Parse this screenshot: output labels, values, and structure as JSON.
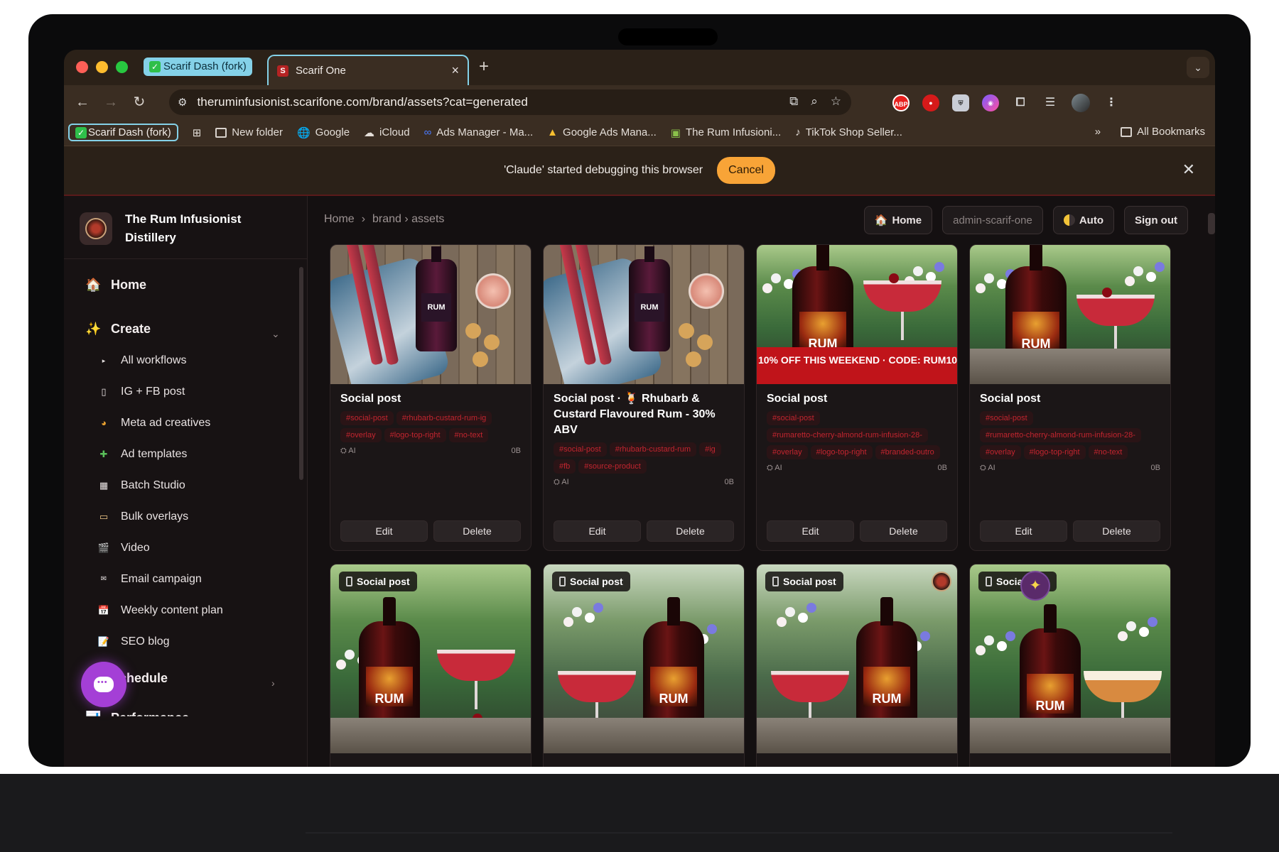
{
  "browser": {
    "tab_group_label": "Scarif Dash (fork)",
    "active_tab_title": "Scarif One",
    "active_tab_favicon": "S",
    "url": "theruminfusionist.scarifone.com/brand/assets?cat=generated",
    "bookmarks": {
      "group_chip": "Scarif Dash (fork)",
      "items": [
        "New folder",
        "Google",
        "iCloud",
        "Ads Manager - Ma...",
        "Google Ads Mana...",
        "The Rum Infusioni...",
        "TikTok Shop Seller..."
      ],
      "overflow": "»",
      "all_bookmarks": "All Bookmarks"
    },
    "extensions": {
      "abp": "ABP"
    },
    "debug_bar": {
      "message": "'Claude' started debugging this browser",
      "cancel_label": "Cancel"
    }
  },
  "sidebar": {
    "brand_name": "The Rum Infusionist Distillery",
    "home_label": "Home",
    "create_label": "Create",
    "create_items": [
      "All workflows",
      "IG + FB post",
      "Meta ad creatives",
      "Ad templates",
      "Batch Studio",
      "Bulk overlays",
      "Video",
      "Email campaign",
      "Weekly content plan",
      "SEO blog"
    ],
    "schedule_label": "Schedule",
    "performance_label": "Performance"
  },
  "header": {
    "breadcrumb": [
      "Home",
      "›",
      "brand › assets"
    ],
    "home_button": "Home",
    "user_label": "admin-scarif-one",
    "theme_button": "Auto",
    "signout_button": "Sign out"
  },
  "cards": [
    {
      "title": "Social post",
      "tags": [
        "#social-post",
        "#rhubarb-custard-rum-ig",
        "#overlay",
        "#logo-top-right",
        "#no-text"
      ],
      "source": "AI",
      "size": "0B"
    },
    {
      "title": "Social post · 🍹 Rhubarb & Custard Flavoured Rum - 30% ABV",
      "tags": [
        "#social-post",
        "#rhubarb-custard-rum",
        "#ig",
        "#fb",
        "#source-product"
      ],
      "source": "AI",
      "size": "0B"
    },
    {
      "title": "Social post",
      "tags": [
        "#social-post",
        "#rumaretto-cherry-almond-rum-infusion-28-",
        "#overlay",
        "#logo-top-right",
        "#branded-outro"
      ],
      "source": "AI",
      "size": "0B",
      "promo_text": "10% OFF THIS WEEKEND · CODE: RUM10"
    },
    {
      "title": "Social post",
      "tags": [
        "#social-post",
        "#rumaretto-cherry-almond-rum-infusion-28-",
        "#overlay",
        "#logo-top-right",
        "#no-text"
      ],
      "source": "AI",
      "size": "0B"
    }
  ],
  "card_actions": {
    "edit": "Edit",
    "delete": "Delete"
  },
  "lower_cards": [
    {
      "badge": "Social post"
    },
    {
      "badge": "Social post"
    },
    {
      "badge": "Social post"
    },
    {
      "badge": "Social post"
    }
  ],
  "bottle_text": {
    "rum": "RUM",
    "rum_large": "RUM"
  }
}
